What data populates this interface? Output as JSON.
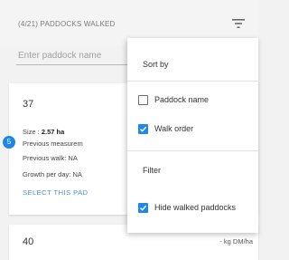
{
  "header": {
    "title": "(4/21) PADDOCKS WALKED",
    "filter_icon": "filter-lines-icon"
  },
  "search": {
    "placeholder": "Enter paddock name"
  },
  "paddocks": [
    {
      "number": "37",
      "size_label": "Size : ",
      "size_value": "2.57 ha",
      "previous_measurement": "Previous measurem",
      "previous_walk": "Previous walk:  NA",
      "growth_per_day": "Growth per day:  NA",
      "walk_order": "5",
      "select_label": "SELECT THIS PAD"
    },
    {
      "number": "40",
      "unit": "- kg DM/ha"
    }
  ],
  "menu": {
    "sort_heading": "Sort by",
    "sort_options": [
      {
        "label": "Paddock name",
        "checked": false
      },
      {
        "label": "Walk order",
        "checked": true
      }
    ],
    "filter_heading": "Filter",
    "filter_options": [
      {
        "label": "Hide walked paddocks",
        "checked": true
      }
    ]
  },
  "colors": {
    "accent": "#1e88e5",
    "link": "#4d8fd8"
  }
}
